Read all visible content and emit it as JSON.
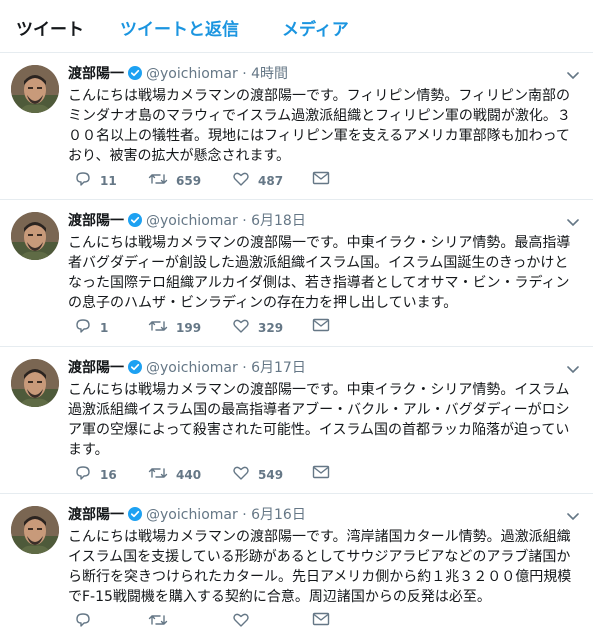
{
  "tabs": [
    {
      "label": "ツイート"
    },
    {
      "label": "ツイートと返信"
    },
    {
      "label": "メディア"
    }
  ],
  "colors": {
    "accent": "#1b95e0",
    "verified": "#1da1f2",
    "muted": "#657786"
  },
  "icons": {
    "reply": "reply-icon",
    "retweet": "retweet-icon",
    "like": "heart-icon",
    "dm": "envelope-icon",
    "menu": "chevron-down-icon",
    "badge": "verified-badge-icon"
  },
  "tweets": [
    {
      "name": "渡部陽一",
      "handle": "@yoichiomar",
      "dot": "·",
      "time": "4時間",
      "text": "こんにちは戦場カメラマンの渡部陽一です。フィリピン情勢。フィリピン南部のミンダナオ島のマラウィでイスラム過激派組織とフィリピン軍の戦闘が激化。３００名以上の犠牲者。現地にはフィリピン軍を支えるアメリカ軍部隊も加わっており、被害の拡大が懸念されます。",
      "replies": "11",
      "retweets": "659",
      "likes": "487"
    },
    {
      "name": "渡部陽一",
      "handle": "@yoichiomar",
      "dot": "·",
      "time": "6月18日",
      "text": "こんにちは戦場カメラマンの渡部陽一です。中東イラク・シリア情勢。最高指導者バグダディーが創設した過激派組織イスラム国。イスラム国誕生のきっかけとなった国際テロ組織アルカイダ側は、若き指導者としてオサマ・ビン・ラディンの息子のハムザ・ビンラディンの存在力を押し出しています。",
      "replies": "1",
      "retweets": "199",
      "likes": "329"
    },
    {
      "name": "渡部陽一",
      "handle": "@yoichiomar",
      "dot": "·",
      "time": "6月17日",
      "text": "こんにちは戦場カメラマンの渡部陽一です。中東イラク・シリア情勢。イスラム過激派組織イスラム国の最高指導者アブー・バクル・アル・バグダディーがロシア軍の空爆によって殺害された可能性。イスラム国の首都ラッカ陥落が迫っています。",
      "replies": "16",
      "retweets": "440",
      "likes": "549"
    },
    {
      "name": "渡部陽一",
      "handle": "@yoichiomar",
      "dot": "·",
      "time": "6月16日",
      "text": "こんにちは戦場カメラマンの渡部陽一です。湾岸諸国カタール情勢。過激派組織イスラム国を支援している形跡があるとしてサウジアラビアなどのアラブ諸国から断行を突きつけられたカタール。先日アメリカ側から約１兆３２００億円規模でF-15戦闘機を購入する契約に合意。周辺諸国からの反発は必至。",
      "replies": "",
      "retweets": "",
      "likes": ""
    }
  ]
}
